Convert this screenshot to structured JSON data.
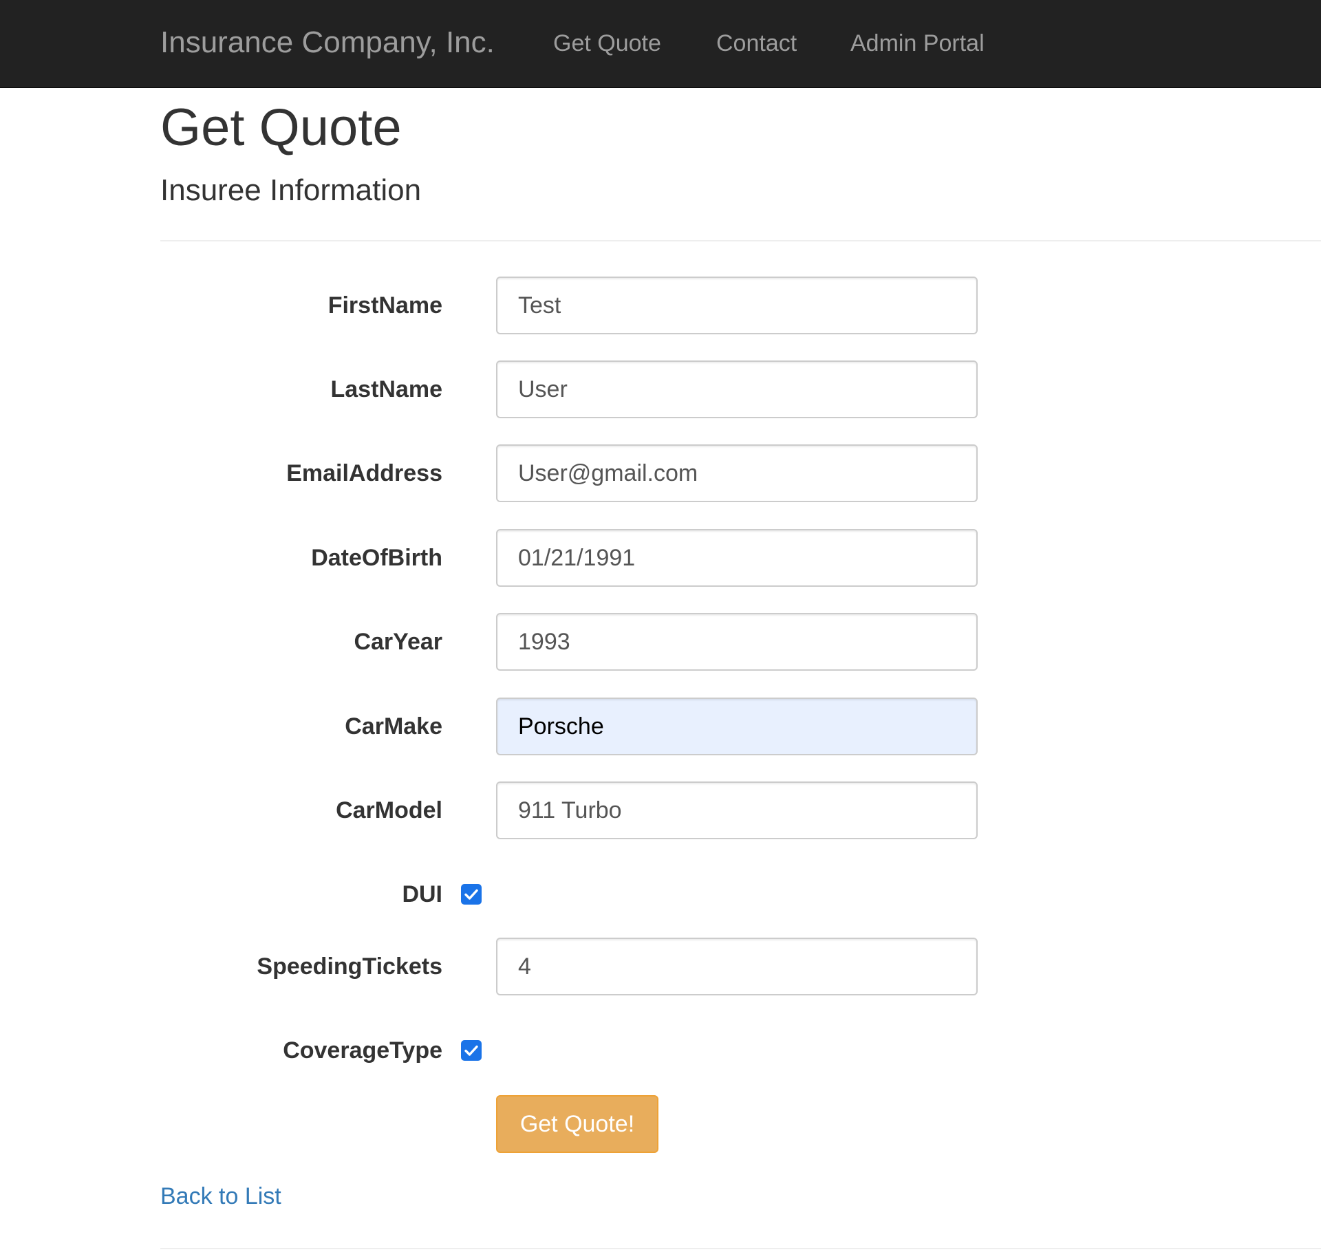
{
  "navbar": {
    "brand": "Insurance Company, Inc.",
    "links": [
      "Get Quote",
      "Contact",
      "Admin Portal"
    ]
  },
  "page": {
    "title": "Get Quote",
    "subtitle": "Insuree Information"
  },
  "form": {
    "first_name": {
      "label": "FirstName",
      "value": "Test"
    },
    "last_name": {
      "label": "LastName",
      "value": "User"
    },
    "email": {
      "label": "EmailAddress",
      "value": "User@gmail.com"
    },
    "dob": {
      "label": "DateOfBirth",
      "value": "01/21/1991"
    },
    "car_year": {
      "label": "CarYear",
      "value": "1993"
    },
    "car_make": {
      "label": "CarMake",
      "value": "Porsche"
    },
    "car_model": {
      "label": "CarModel",
      "value": "911 Turbo"
    },
    "dui": {
      "label": "DUI",
      "checked": true
    },
    "speeding_tickets": {
      "label": "SpeedingTickets",
      "value": "4"
    },
    "coverage_type": {
      "label": "CoverageType",
      "checked": true
    },
    "submit_label": "Get Quote!"
  },
  "back_link": "Back to List",
  "colors": {
    "navbar_bg": "#222222",
    "nav_text": "#9d9d9d",
    "button_warning": "#e8ad5c",
    "link": "#337ab7",
    "checkbox": "#1a73e8",
    "autofill_bg": "#e8f0fe"
  },
  "icons": {
    "checkbox_mark": "checkmark-icon"
  }
}
